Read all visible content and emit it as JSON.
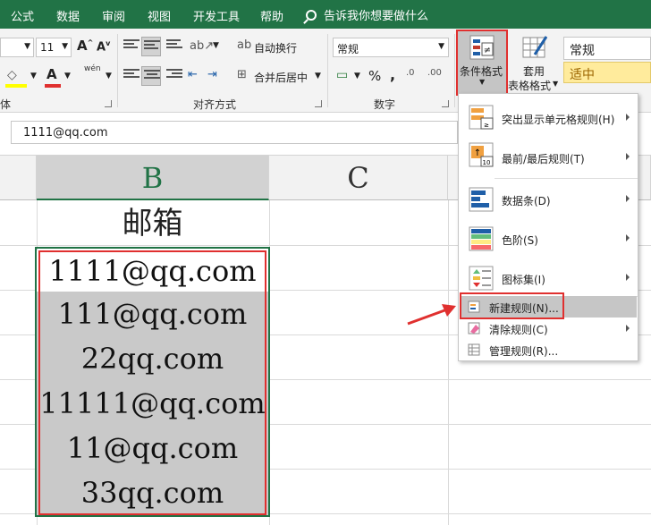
{
  "menubar": {
    "items": [
      "公式",
      "数据",
      "审阅",
      "视图",
      "开发工具",
      "帮助"
    ],
    "search_text": "告诉我你想要做什么"
  },
  "ribbon": {
    "font_size": "11",
    "wrap_text": "自动换行",
    "merge_center": "合并后居中",
    "number_format": "常规",
    "conditional_format": "条件格式",
    "table_format_line1": "套用",
    "table_format_line2": "表格格式",
    "style_normal": "常规",
    "style_neutral": "适中",
    "group_font_tail": "体",
    "group_alignment": "对齐方式",
    "group_number": "数字",
    "wen_label": "wén",
    "percent": "%",
    "comma": ","
  },
  "formula_bar": {
    "content": "1111@qq.com"
  },
  "sheet": {
    "columns": [
      "B",
      "C"
    ],
    "header_cell": "邮箱",
    "rows": [
      "1111@qq.com",
      "111@qq.com",
      "22qq.com",
      "11111@qq.com",
      "11@qq.com",
      "33qq.com"
    ]
  },
  "dropdown": {
    "items": [
      {
        "label": "突出显示单元格规则(H)"
      },
      {
        "label": "最前/最后规则(T)"
      },
      {
        "label": "数据条(D)"
      },
      {
        "label": "色阶(S)"
      },
      {
        "label": "图标集(I)"
      },
      {
        "label": "新建规则(N)..."
      },
      {
        "label": "清除规则(C)"
      },
      {
        "label": "管理规则(R)..."
      }
    ],
    "icon_number": "10"
  },
  "colors": {
    "excel_green": "#217346",
    "highlight_red": "#e0302f",
    "selection_gray": "#c9c9c9",
    "neutral_style_bg": "#ffeb9c",
    "neutral_style_text": "#9c6500"
  }
}
